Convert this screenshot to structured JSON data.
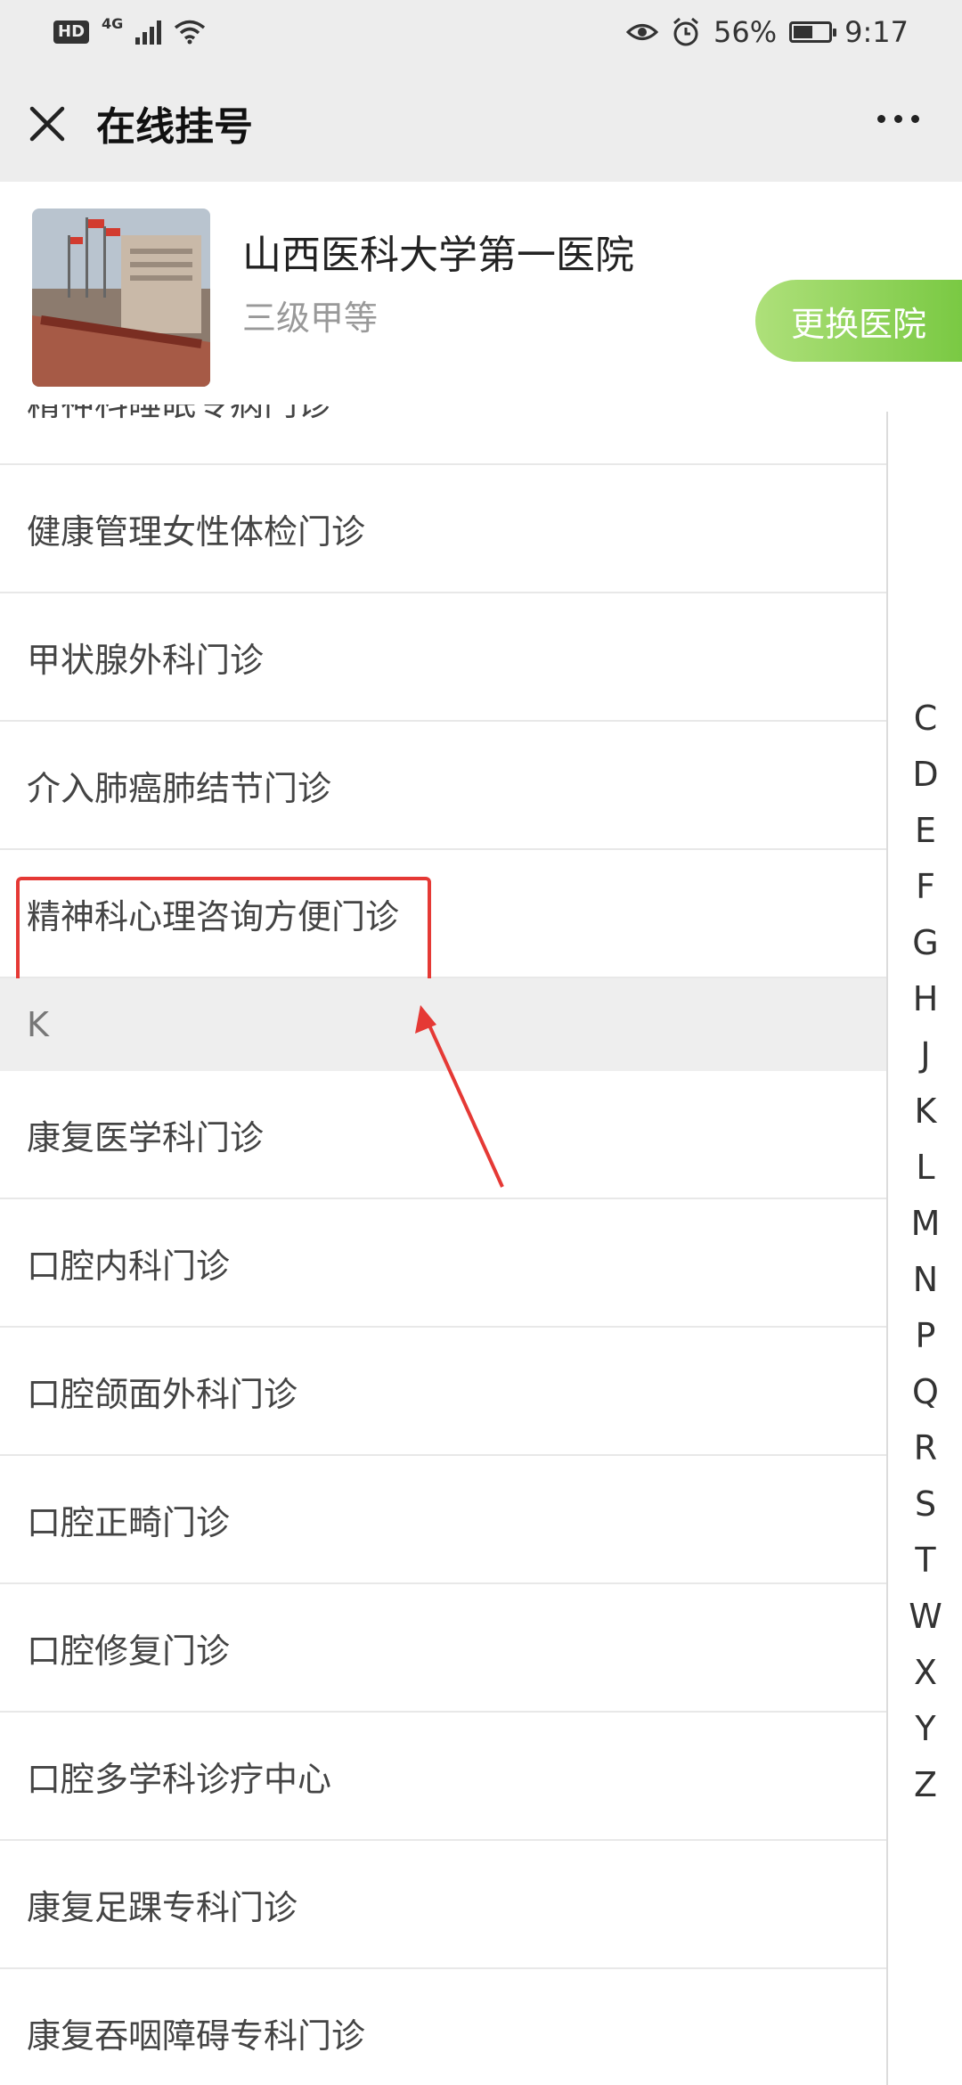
{
  "status_bar": {
    "hd": "HD",
    "network": "4G",
    "battery": "56%",
    "battery_level": 0.56,
    "time": "9:17"
  },
  "nav": {
    "title": "在线挂号"
  },
  "hospital": {
    "name": "山西医科大学第一医院",
    "level": "三级甲等",
    "switch_label": "更换医院"
  },
  "departments": {
    "partial_top": "精神科睡眠专病门诊",
    "before_k": [
      "健康管理女性体检门诊",
      "甲状腺外科门诊",
      "介入肺癌肺结节门诊",
      "精神科心理咨询方便门诊"
    ],
    "section_k": "K",
    "k_items": [
      "康复医学科门诊",
      "口腔内科门诊",
      "口腔颌面外科门诊",
      "口腔正畸门诊",
      "口腔修复门诊",
      "口腔多学科诊疗中心",
      "康复足踝专科门诊",
      "康复吞咽障碍专科门诊"
    ]
  },
  "index_letters": [
    "C",
    "D",
    "E",
    "F",
    "G",
    "H",
    "J",
    "K",
    "L",
    "M",
    "N",
    "P",
    "Q",
    "R",
    "S",
    "T",
    "W",
    "X",
    "Y",
    "Z"
  ],
  "colors": {
    "highlight": "#e53935",
    "switch_button": "#7ac943"
  }
}
